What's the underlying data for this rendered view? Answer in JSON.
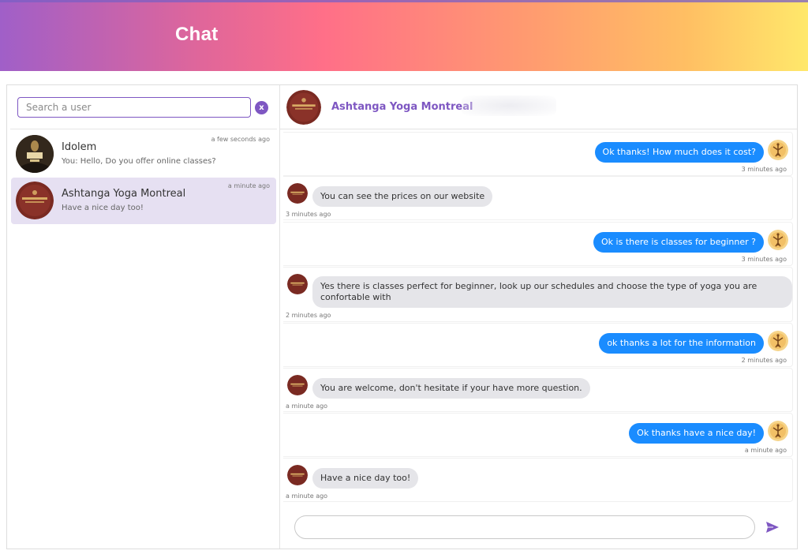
{
  "header": {
    "title": "Chat"
  },
  "search": {
    "placeholder": "Search a user",
    "clear_label": "x"
  },
  "conversations": [
    {
      "name": "Idolem",
      "preview": "You: Hello, Do you offer online classes?",
      "time": "a few seconds ago",
      "selected": false,
      "avatar": "idolem-logo-avatar"
    },
    {
      "name": "Ashtanga Yoga Montreal",
      "preview": "Have a nice day too!",
      "time": "a minute ago",
      "selected": true,
      "avatar": "ashtanga-logo-avatar"
    }
  ],
  "chat_header": {
    "name": "Ashtanga Yoga Montreal"
  },
  "messages": [
    {
      "direction": "out",
      "text": "Ok thanks! How much does it cost?",
      "time": "3 minutes ago"
    },
    {
      "direction": "in",
      "text": "You can see the prices on our website",
      "time": "3 minutes ago"
    },
    {
      "direction": "out",
      "text": "Ok is there is classes for beginner ?",
      "time": "3 minutes ago"
    },
    {
      "direction": "in",
      "text": "Yes there is classes perfect for beginner, look up our schedules and choose the type of yoga you are confortable with",
      "time": "2 minutes ago"
    },
    {
      "direction": "out",
      "text": "ok thanks a lot for the information",
      "time": "2 minutes ago"
    },
    {
      "direction": "in",
      "text": "You are welcome, don't hesitate if your have more question.",
      "time": "a minute ago"
    },
    {
      "direction": "out",
      "text": "Ok thanks have a nice day!",
      "time": "a minute ago"
    },
    {
      "direction": "in",
      "text": "Have a nice day too!",
      "time": "a minute ago"
    }
  ],
  "composer": {
    "value": "",
    "send_icon": "send-icon"
  },
  "colors": {
    "accent": "#7e57c2",
    "outgoing_bubble": "#1a8cff",
    "incoming_bubble": "#e5e5e9",
    "selected_row": "#e6e0f2"
  }
}
